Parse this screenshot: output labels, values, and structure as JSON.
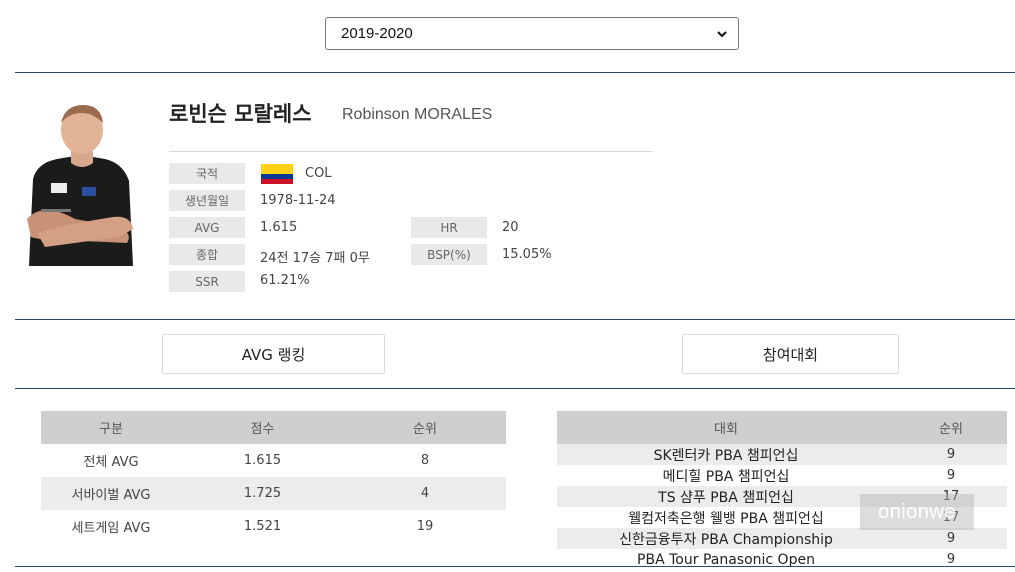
{
  "season_select": {
    "selected": "2019-2020"
  },
  "player": {
    "name_ko": "로빈슨 모랄레스",
    "name_en": "Robinson MORALES",
    "photo_icon": "player-photo-icon",
    "flag_colors": [
      "#FCD116",
      "#003893",
      "#CE1126"
    ],
    "fields": {
      "nationality": {
        "label": "국적",
        "value": "COL"
      },
      "birth": {
        "label": "생년월일",
        "value": "1978-11-24"
      },
      "avg": {
        "label": "AVG",
        "value": "1.615"
      },
      "hr": {
        "label": "HR",
        "value": "20"
      },
      "total": {
        "label": "종합",
        "value": "24전 17승 7패 0무"
      },
      "bsp": {
        "label": "BSP(%)",
        "value": "15.05%"
      },
      "ssr": {
        "label": "SSR",
        "value": "61.21%"
      }
    }
  },
  "tabs": {
    "avg_ranking": "AVG 랭킹",
    "tournaments": "참여대회"
  },
  "avg_table": {
    "headers": [
      "구분",
      "점수",
      "순위"
    ],
    "rows": [
      [
        "전체 AVG",
        "1.615",
        "8"
      ],
      [
        "서바이벌 AVG",
        "1.725",
        "4"
      ],
      [
        "세트게임 AVG",
        "1.521",
        "19"
      ]
    ]
  },
  "tour_table": {
    "headers": [
      "대회",
      "순위"
    ],
    "rows": [
      [
        "SK렌터카 PBA 챔피언십",
        "9"
      ],
      [
        "메디힐 PBA 챔피언십",
        "9"
      ],
      [
        "TS 샴푸 PBA 챔피언십",
        "17"
      ],
      [
        "웰컴저축은행 웰뱅 PBA 챔피언십",
        "17"
      ],
      [
        "신한금융투자 PBA Championship",
        "9"
      ],
      [
        "PBA Tour Panasonic Open",
        "9"
      ]
    ]
  },
  "watermark": "onionwe"
}
